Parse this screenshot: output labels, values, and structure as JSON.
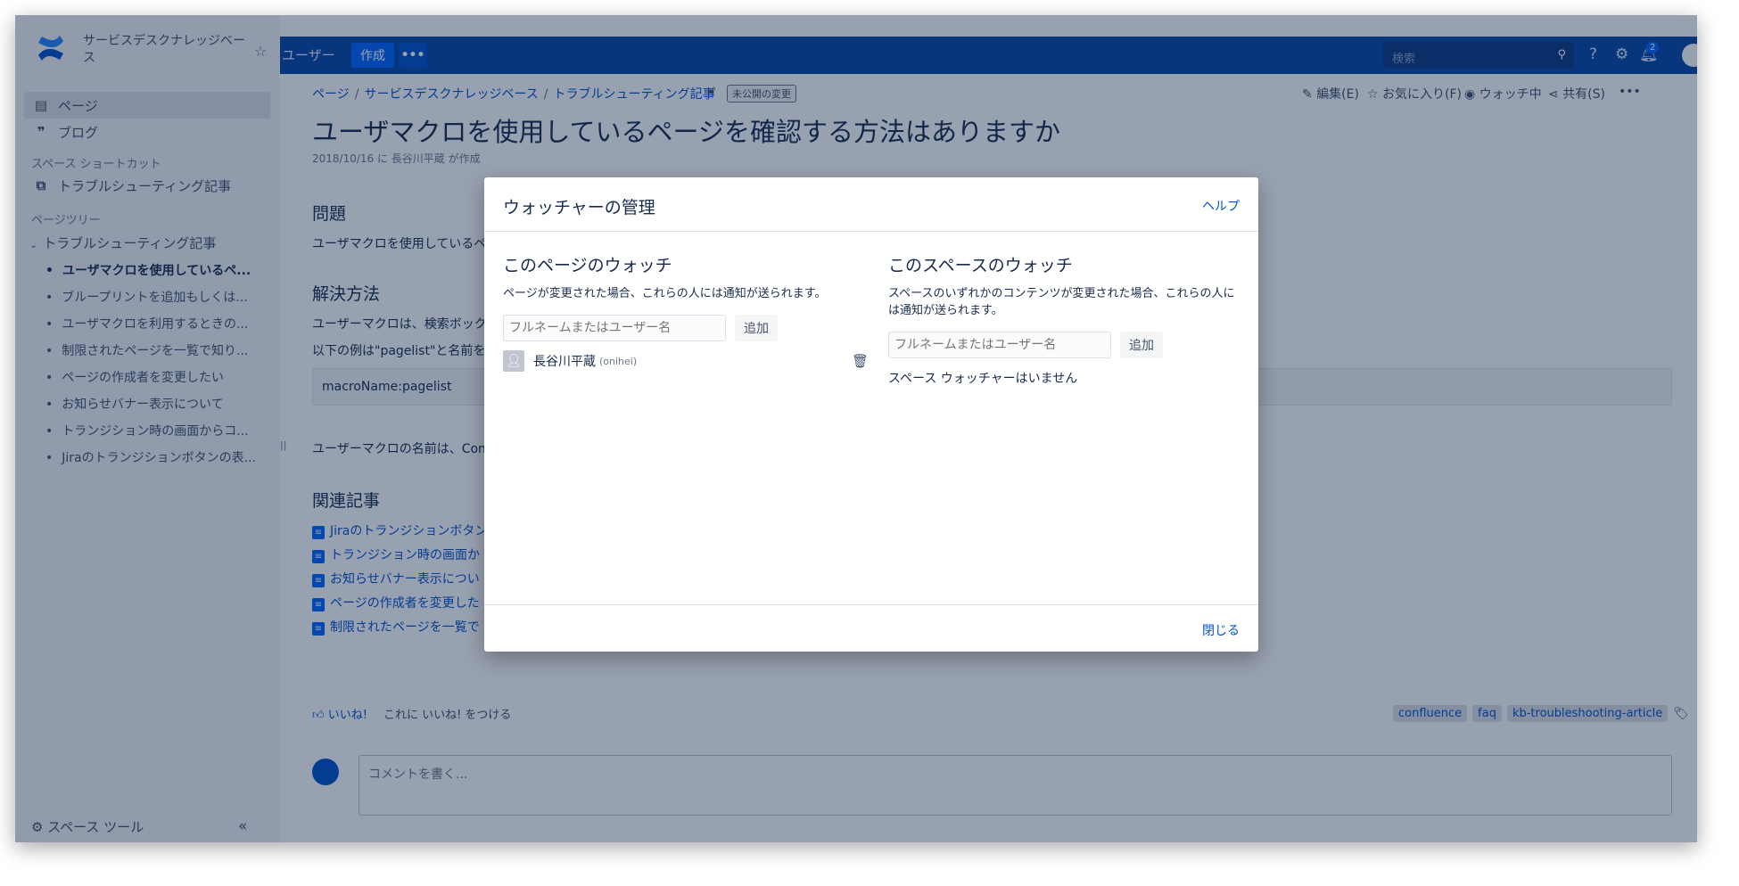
{
  "sidebar": {
    "space_title": "サービスデスクナレッジベース",
    "pages_label": "ページ",
    "blog_label": "ブログ",
    "shortcut_heading": "スペース ショートカット",
    "shortcut_item": "トラブルシューティング記事",
    "tree_heading": "ページツリー",
    "tree_root": "トラブルシューティング記事",
    "tree_children": [
      "ユーザマクロを使用しているペ...",
      "ブループリントを追加もしくは...",
      "ユーザマクロを利用するときの...",
      "制限されたページを一覧で知り...",
      "ページの作成者を変更したい",
      "お知らせバナー表示について",
      "トランジション時の画面からコ...",
      "Jiraのトランジションボタンの表..."
    ],
    "tools_label": "スペース ツール",
    "collapse_label": "«"
  },
  "topbar": {
    "users_label": "ユーザー",
    "create_label": "作成",
    "more_label": "•••",
    "search_placeholder": "検索",
    "notification_count": "2"
  },
  "breadcrumb": {
    "items": [
      "ページ",
      "サービスデスクナレッジベース",
      "トラブルシューティング記事"
    ],
    "unpublished_badge": "未公開の変更"
  },
  "page_actions": {
    "edit": "編集(E)",
    "favorite": "お気に入り(F)",
    "watching": "ウォッチ中",
    "share": "共有(S)",
    "more": "•••"
  },
  "page": {
    "title": "ユーザマクロを使用しているページを確認する方法はありますか",
    "byline": "2018/10/16 に 長谷川平蔵 が作成",
    "problem_heading": "問題",
    "problem_text": "ユーザマクロを使用しているペ",
    "solution_heading": "解決方法",
    "solution_text_1": "ユーザーマクロは、検索ボック",
    "solution_text_2": "以下の例は\"pagelist\"と名前を",
    "code": "macroName:pagelist",
    "solution_text_3": "ユーザーマクロの名前は、Con",
    "related_heading": "関連記事",
    "related_items": [
      "Jiraのトランジションボタン",
      "トランジション時の画面か",
      "お知らせバナー表示につい",
      "ページの作成者を変更した",
      "制限されたページを一覧で"
    ],
    "like_label": "いいね!",
    "like_prompt": "これに いいね! をつける",
    "labels": [
      "confluence",
      "faq",
      "kb-troubleshooting-article"
    ],
    "comment_placeholder": "コメントを書く..."
  },
  "dialog": {
    "title": "ウォッチャーの管理",
    "help": "ヘルプ",
    "page_watch": {
      "heading": "このページのウォッチ",
      "description": "ページが変更された場合、これらの人には通知が送られます。",
      "input_placeholder": "フルネームまたはユーザー名",
      "add_button": "追加",
      "watcher_name": "長谷川平蔵",
      "watcher_id": "(onihei)"
    },
    "space_watch": {
      "heading": "このスペースのウォッチ",
      "description": "スペースのいずれかのコンテンツが変更された場合、これらの人には通知が送られます。",
      "input_placeholder": "フルネームまたはユーザー名",
      "add_button": "追加",
      "empty_text": "スペース ウォッチャーはいません"
    },
    "close": "閉じる"
  }
}
